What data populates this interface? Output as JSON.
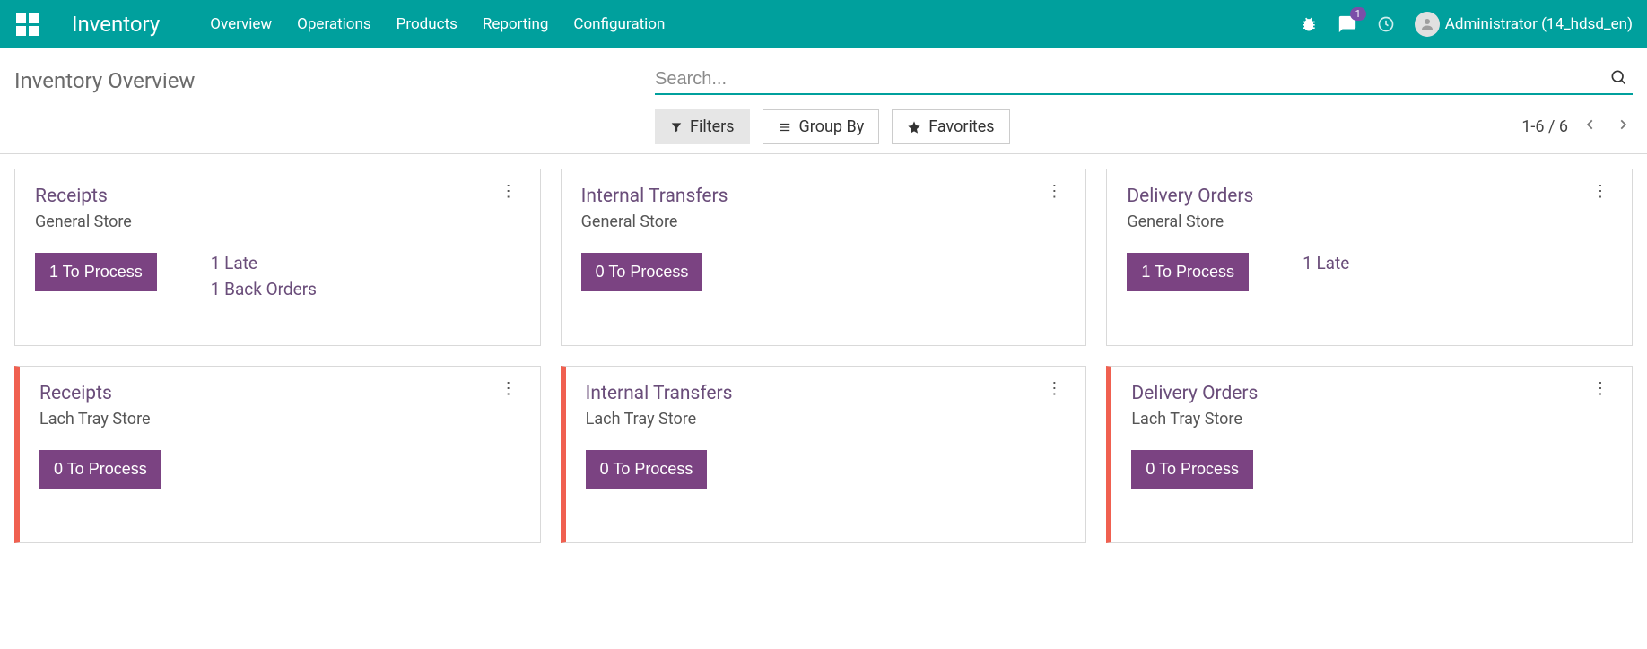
{
  "header": {
    "app_title": "Inventory",
    "nav": [
      "Overview",
      "Operations",
      "Products",
      "Reporting",
      "Configuration"
    ],
    "chat_badge": "1",
    "user_name": "Administrator (14_hdsd_en)"
  },
  "page": {
    "title": "Inventory Overview",
    "search_placeholder": "Search...",
    "filters_label": "Filters",
    "groupby_label": "Group By",
    "favorites_label": "Favorites",
    "pager": "1-6 / 6"
  },
  "cards": [
    {
      "title": "Receipts",
      "subtitle": "General Store",
      "button": "1 To Process",
      "statuses": [
        "1 Late",
        "1 Back Orders"
      ],
      "hot": false
    },
    {
      "title": "Internal Transfers",
      "subtitle": "General Store",
      "button": "0 To Process",
      "statuses": [],
      "hot": false
    },
    {
      "title": "Delivery Orders",
      "subtitle": "General Store",
      "button": "1 To Process",
      "statuses": [
        "1 Late"
      ],
      "hot": false
    },
    {
      "title": "Receipts",
      "subtitle": "Lach Tray Store",
      "button": "0 To Process",
      "statuses": [],
      "hot": true
    },
    {
      "title": "Internal Transfers",
      "subtitle": "Lach Tray Store",
      "button": "0 To Process",
      "statuses": [],
      "hot": true
    },
    {
      "title": "Delivery Orders",
      "subtitle": "Lach Tray Store",
      "button": "0 To Process",
      "statuses": [],
      "hot": true
    }
  ]
}
